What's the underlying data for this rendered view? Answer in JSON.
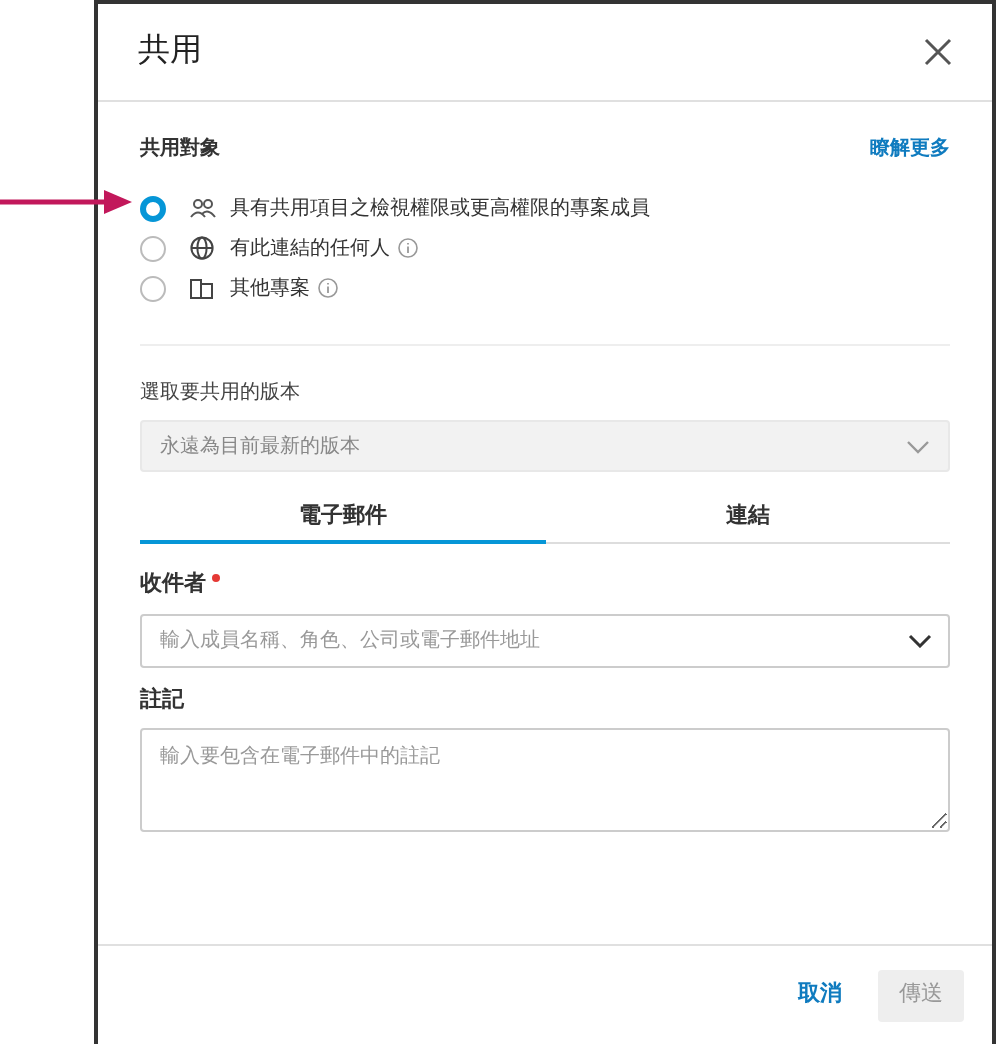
{
  "dialog": {
    "title": "共用"
  },
  "share_with": {
    "label": "共用對象",
    "link": "瞭解更多",
    "options": [
      {
        "kind": "group",
        "label": "具有共用項目之檢視權限或更高權限的專案成員",
        "info": false,
        "selected": true
      },
      {
        "kind": "globe",
        "label": "有此連結的任何人",
        "info": true,
        "selected": false
      },
      {
        "kind": "project",
        "label": "其他專案",
        "info": true,
        "selected": false
      }
    ]
  },
  "version": {
    "label": "選取要共用的版本",
    "value": "永遠為目前最新的版本",
    "disabled": true
  },
  "tabs": [
    {
      "label": "電子郵件",
      "selected": true
    },
    {
      "label": "連結",
      "selected": false
    }
  ],
  "recipients": {
    "label": "收件者",
    "required": true,
    "placeholder": "輸入成員名稱、角色、公司或電子郵件地址"
  },
  "notes": {
    "label": "註記",
    "placeholder": "輸入要包含在電子郵件中的註記"
  },
  "buttons": [
    {
      "kind": "link",
      "label": "取消",
      "disabled": false
    },
    {
      "kind": "primary",
      "label": "傳送",
      "disabled": true
    }
  ]
}
